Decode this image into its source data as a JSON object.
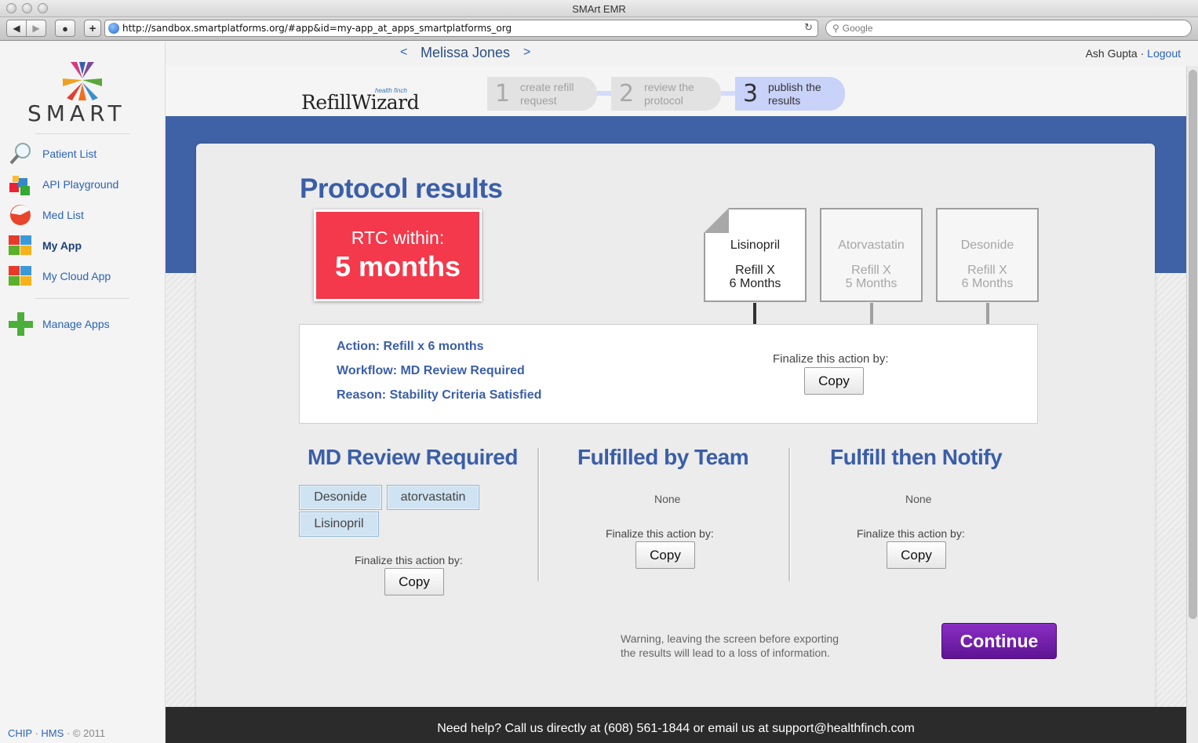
{
  "window": {
    "title": "SMArt EMR"
  },
  "browser": {
    "url": "http://sandbox.smartplatforms.org/#app&id=my-app_at_apps_smartplatforms_org",
    "search_placeholder": "Google",
    "back_icon": "back-arrow-icon",
    "forward_icon": "forward-arrow-icon"
  },
  "sidebar": {
    "logo_text": "SMART",
    "items": [
      {
        "label": "Patient List",
        "icon": "magnifier-icon"
      },
      {
        "label": "API Playground",
        "icon": "blocks-icon"
      },
      {
        "label": "Med List",
        "icon": "pill-icon"
      },
      {
        "label": "My App",
        "icon": "app-grid-icon",
        "active": true
      },
      {
        "label": "My Cloud App",
        "icon": "app-grid-icon"
      }
    ],
    "manage_apps": "Manage Apps",
    "footer": {
      "chip": "CHIP",
      "hms": "HMS",
      "dot": "·",
      "copyright": "© 2011"
    }
  },
  "patient_header": {
    "prev": "<",
    "name": "Melissa Jones",
    "next": ">",
    "user": "Ash Gupta",
    "sep": "·",
    "logout": "Logout"
  },
  "app": {
    "brand": "RefillWizard",
    "brand_small": "health finch",
    "steps": [
      {
        "num": "1",
        "line1": "create refill",
        "line2": "request",
        "active": false
      },
      {
        "num": "2",
        "line1": "review the",
        "line2": "protocol",
        "active": false
      },
      {
        "num": "3",
        "line1": "publish the",
        "line2": "results",
        "active": true
      }
    ],
    "title": "Protocol results",
    "rtc": {
      "label": "RTC within:",
      "value": "5 months"
    },
    "meds": [
      {
        "name": "Lisinopril",
        "refill": "Refill X",
        "months": "6 Months",
        "selected": true
      },
      {
        "name": "Atorvastatin",
        "refill": "Refill X",
        "months": "5 Months",
        "selected": false
      },
      {
        "name": "Desonide",
        "refill": "Refill X",
        "months": "6 Months",
        "selected": false
      }
    ],
    "action": {
      "action": "Action: Refill x 6 months",
      "workflow": "Workflow: MD Review Required",
      "reason": "Reason: Stability Criteria Satisfied",
      "finalize_label": "Finalize this action by:",
      "copy": "Copy"
    },
    "columns": [
      {
        "title": "MD Review Required",
        "tags": [
          "Desonide",
          "atorvastatin",
          "Lisinopril"
        ],
        "finalize_label": "Finalize this action by:",
        "copy": "Copy"
      },
      {
        "title": "Fulfilled by Team",
        "none": "None",
        "finalize_label": "Finalize this action by:",
        "copy": "Copy"
      },
      {
        "title": "Fulfill then Notify",
        "none": "None",
        "finalize_label": "Finalize this action by:",
        "copy": "Copy"
      }
    ],
    "warning_line1": "Warning, leaving the screen before exporting",
    "warning_line2": "the results will lead to a loss of information.",
    "continue": "Continue",
    "footer": "Need help? Call us directly at (608) 561-1844 or email us at support@healthfinch.com"
  },
  "colors": {
    "brand_blue": "#3a5ea8",
    "rtc_red": "#f3394b",
    "continue_purple": "#6e1fa8",
    "band_blue": "#3f62a6"
  }
}
